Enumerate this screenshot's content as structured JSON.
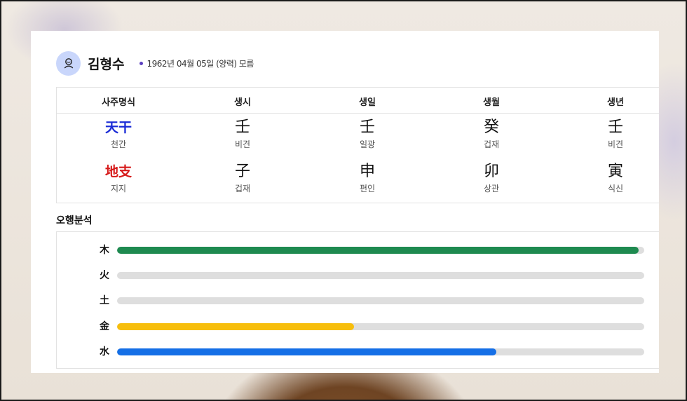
{
  "profile": {
    "name": "김형수",
    "birth_info": "1962년 04월 05일 (양력) 모름"
  },
  "saju_table": {
    "headers": [
      "사주명식",
      "생시",
      "생일",
      "생월",
      "생년"
    ],
    "stems": {
      "label": "天干",
      "label_kor": "천간",
      "label_color": "#1a2bd6",
      "chars": [
        "壬",
        "壬",
        "癸",
        "壬"
      ],
      "roles": [
        "비견",
        "일광",
        "겁재",
        "비견"
      ]
    },
    "branches": {
      "label": "地支",
      "label_kor": "지지",
      "label_color": "#d61a1a",
      "chars": [
        "子",
        "申",
        "卯",
        "寅"
      ],
      "roles": [
        "겁재",
        "편인",
        "상관",
        "식신"
      ]
    }
  },
  "five_elements": {
    "title": "오행분석",
    "items": [
      {
        "label": "木",
        "value": 0.99,
        "color": "#1e8a50"
      },
      {
        "label": "火",
        "value": 0,
        "color": "#dedede"
      },
      {
        "label": "土",
        "value": 0,
        "color": "#dedede"
      },
      {
        "label": "金",
        "value": 0.45,
        "color": "#f7be0c"
      },
      {
        "label": "水",
        "value": 0.72,
        "color": "#156fe6"
      }
    ]
  }
}
